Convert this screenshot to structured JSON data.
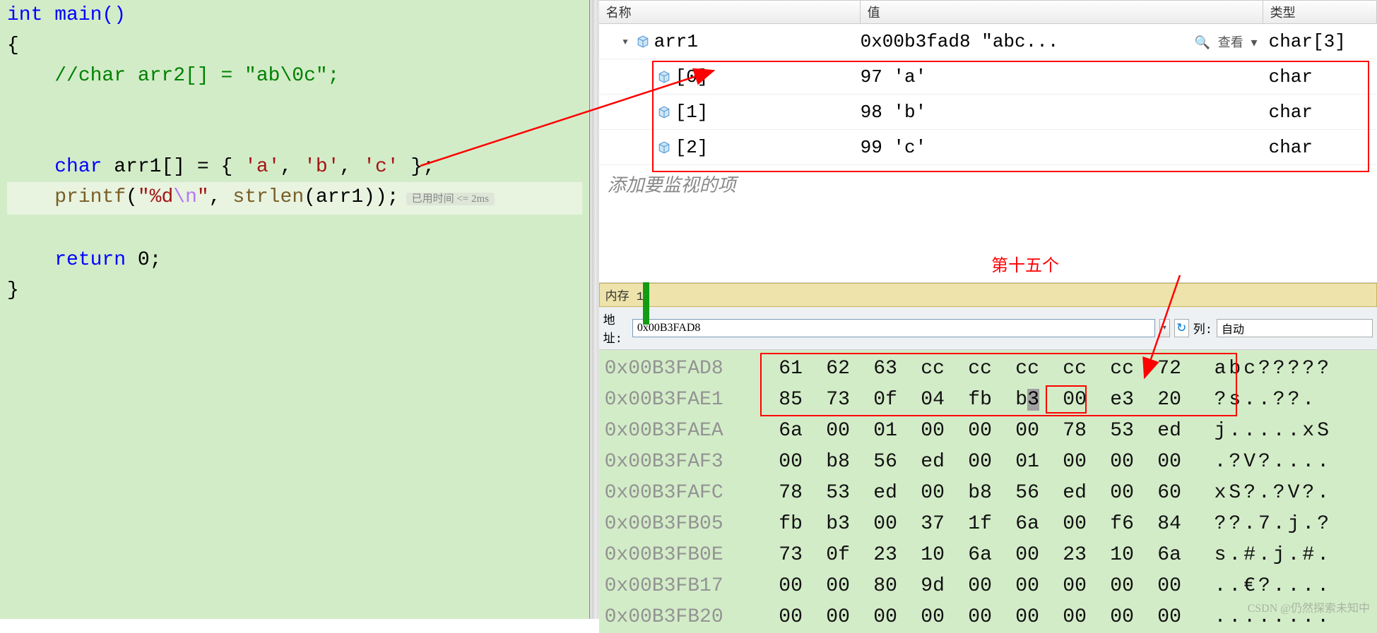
{
  "code": {
    "line0": "int main()",
    "brace_open": "{",
    "comment_line": "    //char arr2[] = \"ab\\0c\";",
    "decl_pre": "    ",
    "kw_char": "char",
    "decl_mid": " arr1[] = { ",
    "lit_a": "'a'",
    "lit_b": "'b'",
    "lit_c": "'c'",
    "decl_end": " };",
    "printf_name": "printf",
    "printf_open": "(",
    "fmt_q1": "\"",
    "fmt_spec": "%d",
    "fmt_esc": "\\n",
    "fmt_q2": "\"",
    "printf_mid": ", ",
    "strlen_name": "strlen",
    "printf_arg": "(arr1));",
    "hint": "已用时间 <= 2ms",
    "return_kw": "return",
    "return_val": " 0;",
    "brace_close": "}"
  },
  "watch": {
    "headers": {
      "name": "名称",
      "value": "值",
      "type": "类型"
    },
    "rows": [
      {
        "indent": 0,
        "exp": "▾",
        "name": "arr1",
        "value": "0x00b3fad8 \"abc...",
        "view": "查看",
        "type": "char[3]"
      },
      {
        "indent": 1,
        "exp": "",
        "name": "[0]",
        "value": "97 'a'",
        "view": "",
        "type": "char"
      },
      {
        "indent": 1,
        "exp": "",
        "name": "[1]",
        "value": "98 'b'",
        "view": "",
        "type": "char"
      },
      {
        "indent": 1,
        "exp": "",
        "name": "[2]",
        "value": "99 'c'",
        "view": "",
        "type": "char"
      }
    ],
    "prompt": "添加要监视的项"
  },
  "annotation_fifteenth": "第十五个",
  "memory": {
    "title": "内存 1",
    "addr_label": "地址:",
    "addr_value": "0x00B3FAD8",
    "col_label": "列:",
    "col_value": "自动",
    "rows": [
      {
        "addr": "0x00B3FAD8",
        "bytes": [
          "61",
          "62",
          "63",
          "cc",
          "cc",
          "cc",
          "cc",
          "cc",
          "72"
        ],
        "ascii": "abc?????"
      },
      {
        "addr": "0x00B3FAE1",
        "bytes": [
          "85",
          "73",
          "0f",
          "04",
          "fb",
          "b3",
          "00",
          "e3",
          "20"
        ],
        "ascii": "?s..??. "
      },
      {
        "addr": "0x00B3FAEA",
        "bytes": [
          "6a",
          "00",
          "01",
          "00",
          "00",
          "00",
          "78",
          "53",
          "ed"
        ],
        "ascii": "j.....xS"
      },
      {
        "addr": "0x00B3FAF3",
        "bytes": [
          "00",
          "b8",
          "56",
          "ed",
          "00",
          "01",
          "00",
          "00",
          "00"
        ],
        "ascii": ".?V?...."
      },
      {
        "addr": "0x00B3FAFC",
        "bytes": [
          "78",
          "53",
          "ed",
          "00",
          "b8",
          "56",
          "ed",
          "00",
          "60"
        ],
        "ascii": "xS?.?V?."
      },
      {
        "addr": "0x00B3FB05",
        "bytes": [
          "fb",
          "b3",
          "00",
          "37",
          "1f",
          "6a",
          "00",
          "f6",
          "84"
        ],
        "ascii": "??.7.j.?"
      },
      {
        "addr": "0x00B3FB0E",
        "bytes": [
          "73",
          "0f",
          "23",
          "10",
          "6a",
          "00",
          "23",
          "10",
          "6a"
        ],
        "ascii": "s.#.j.#."
      },
      {
        "addr": "0x00B3FB17",
        "bytes": [
          "00",
          "00",
          "80",
          "9d",
          "00",
          "00",
          "00",
          "00",
          "00"
        ],
        "ascii": "..€?...."
      },
      {
        "addr": "0x00B3FB20",
        "bytes": [
          "00",
          "00",
          "00",
          "00",
          "00",
          "00",
          "00",
          "00",
          "00"
        ],
        "ascii": "........"
      }
    ]
  },
  "watermark": "CSDN @仍然探索未知中"
}
